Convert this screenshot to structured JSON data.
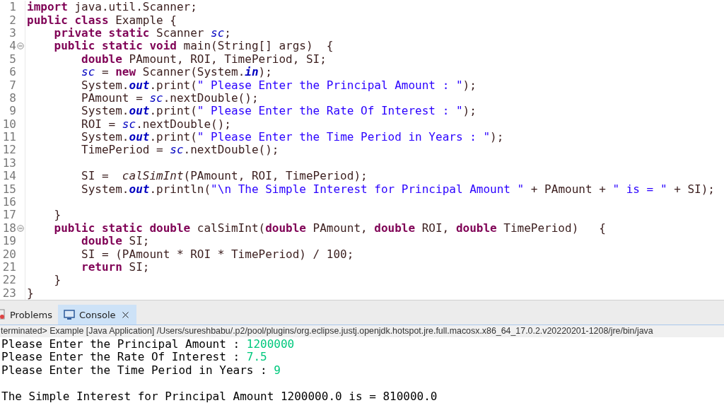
{
  "editor": {
    "lines": [
      {
        "number": "1",
        "fold": false,
        "tokens": [
          {
            "text": "import",
            "kind": "keyword"
          },
          {
            "text": " java.util.Scanner;",
            "kind": "plain"
          }
        ]
      },
      {
        "number": "2",
        "fold": false,
        "tokens": [
          {
            "text": "public class",
            "kind": "keyword"
          },
          {
            "text": " Example {",
            "kind": "plain"
          }
        ]
      },
      {
        "number": "3",
        "fold": false,
        "tokens": [
          {
            "text": "    private static",
            "kind": "keyword"
          },
          {
            "text": " Scanner ",
            "kind": "plain"
          },
          {
            "text": "sc",
            "kind": "field"
          },
          {
            "text": ";",
            "kind": "plain"
          }
        ]
      },
      {
        "number": "4",
        "fold": true,
        "tokens": [
          {
            "text": "    public static void",
            "kind": "keyword"
          },
          {
            "text": " main(String[] args)  {",
            "kind": "plain"
          }
        ]
      },
      {
        "number": "5",
        "fold": false,
        "tokens": [
          {
            "text": "        double",
            "kind": "keyword"
          },
          {
            "text": " PAmount, ROI, TimePeriod, SI;",
            "kind": "plain"
          }
        ]
      },
      {
        "number": "6",
        "fold": false,
        "tokens": [
          {
            "text": "        sc",
            "kind": "field"
          },
          {
            "text": " = ",
            "kind": "plain"
          },
          {
            "text": "new",
            "kind": "keyword"
          },
          {
            "text": " Scanner(System.",
            "kind": "plain"
          },
          {
            "text": "in",
            "kind": "static"
          },
          {
            "text": ");",
            "kind": "plain"
          }
        ]
      },
      {
        "number": "7",
        "fold": false,
        "tokens": [
          {
            "text": "        System.",
            "kind": "plain"
          },
          {
            "text": "out",
            "kind": "static"
          },
          {
            "text": ".print(",
            "kind": "plain"
          },
          {
            "text": "\" Please Enter the Principal Amount : \"",
            "kind": "string"
          },
          {
            "text": ");",
            "kind": "plain"
          }
        ]
      },
      {
        "number": "8",
        "fold": false,
        "tokens": [
          {
            "text": "        PAmount = ",
            "kind": "plain"
          },
          {
            "text": "sc",
            "kind": "field"
          },
          {
            "text": ".nextDouble();",
            "kind": "plain"
          }
        ]
      },
      {
        "number": "9",
        "fold": false,
        "tokens": [
          {
            "text": "        System.",
            "kind": "plain"
          },
          {
            "text": "out",
            "kind": "static"
          },
          {
            "text": ".print(",
            "kind": "plain"
          },
          {
            "text": "\" Please Enter the Rate Of Interest : \"",
            "kind": "string"
          },
          {
            "text": ");",
            "kind": "plain"
          }
        ]
      },
      {
        "number": "10",
        "fold": false,
        "tokens": [
          {
            "text": "        ROI = ",
            "kind": "plain"
          },
          {
            "text": "sc",
            "kind": "field"
          },
          {
            "text": ".nextDouble();",
            "kind": "plain"
          }
        ]
      },
      {
        "number": "11",
        "fold": false,
        "tokens": [
          {
            "text": "        System.",
            "kind": "plain"
          },
          {
            "text": "out",
            "kind": "static"
          },
          {
            "text": ".print(",
            "kind": "plain"
          },
          {
            "text": "\" Please Enter the Time Period in Years : \"",
            "kind": "string"
          },
          {
            "text": ");",
            "kind": "plain"
          }
        ]
      },
      {
        "number": "12",
        "fold": false,
        "tokens": [
          {
            "text": "        TimePeriod = ",
            "kind": "plain"
          },
          {
            "text": "sc",
            "kind": "field"
          },
          {
            "text": ".nextDouble();",
            "kind": "plain"
          }
        ]
      },
      {
        "number": "13",
        "fold": false
      },
      {
        "number": "14",
        "fold": false,
        "tokens": [
          {
            "text": "        SI =  ",
            "kind": "plain"
          },
          {
            "text": "calSimInt",
            "kind": "call"
          },
          {
            "text": "(PAmount, ROI, TimePeriod);",
            "kind": "plain"
          }
        ]
      },
      {
        "number": "15",
        "fold": false,
        "tokens": [
          {
            "text": "        System.",
            "kind": "plain"
          },
          {
            "text": "out",
            "kind": "static"
          },
          {
            "text": ".println(",
            "kind": "plain"
          },
          {
            "text": "\"\\n The Simple Interest for Principal Amount \"",
            "kind": "string"
          },
          {
            "text": " + PAmount + ",
            "kind": "plain"
          },
          {
            "text": "\" is = \"",
            "kind": "string"
          },
          {
            "text": " + SI);",
            "kind": "plain"
          }
        ]
      },
      {
        "number": "16",
        "fold": false
      },
      {
        "number": "17",
        "fold": false,
        "tokens": [
          {
            "text": "    }",
            "kind": "plain"
          }
        ]
      },
      {
        "number": "18",
        "fold": true,
        "tokens": [
          {
            "text": "    public static double",
            "kind": "keyword"
          },
          {
            "text": " calSimInt(",
            "kind": "plain"
          },
          {
            "text": "double",
            "kind": "keyword"
          },
          {
            "text": " PAmount, ",
            "kind": "plain"
          },
          {
            "text": "double",
            "kind": "keyword"
          },
          {
            "text": " ROI, ",
            "kind": "plain"
          },
          {
            "text": "double",
            "kind": "keyword"
          },
          {
            "text": " TimePeriod)   {",
            "kind": "plain"
          }
        ]
      },
      {
        "number": "19",
        "fold": false,
        "tokens": [
          {
            "text": "        double",
            "kind": "keyword"
          },
          {
            "text": " SI;",
            "kind": "plain"
          }
        ]
      },
      {
        "number": "20",
        "fold": false,
        "tokens": [
          {
            "text": "        SI = (PAmount * ROI * TimePeriod) / 100;",
            "kind": "plain"
          }
        ]
      },
      {
        "number": "21",
        "fold": false,
        "tokens": [
          {
            "text": "        return",
            "kind": "keyword"
          },
          {
            "text": " SI;",
            "kind": "plain"
          }
        ]
      },
      {
        "number": "22",
        "fold": false,
        "tokens": [
          {
            "text": "    }",
            "kind": "plain"
          }
        ]
      },
      {
        "number": "23",
        "fold": false,
        "tokens": [
          {
            "text": "}",
            "kind": "plain"
          }
        ]
      }
    ]
  },
  "panel": {
    "tabs": [
      {
        "label": "Problems",
        "selected": false,
        "closable": false
      },
      {
        "label": "Console",
        "selected": true,
        "closable": true
      }
    ],
    "process": "terminated> Example [Java Application] /Users/sureshbabu/.p2/pool/plugins/org.eclipse.justj.openjdk.hotspot.jre.full.macosx.x86_64_17.0.2.v20220201-1208/jre/bin/java",
    "console": [
      {
        "kind": "prompt",
        "text": "Please Enter the Principal Amount : ",
        "input": "1200000"
      },
      {
        "kind": "prompt",
        "text": "Please Enter the Rate Of Interest : ",
        "input": "7.5"
      },
      {
        "kind": "prompt",
        "text": "Please Enter the Time Period in Years : ",
        "input": "9"
      },
      {
        "kind": "result",
        "text": "The Simple Interest for Principal Amount 1200000.0 is = 810000.0"
      }
    ]
  }
}
